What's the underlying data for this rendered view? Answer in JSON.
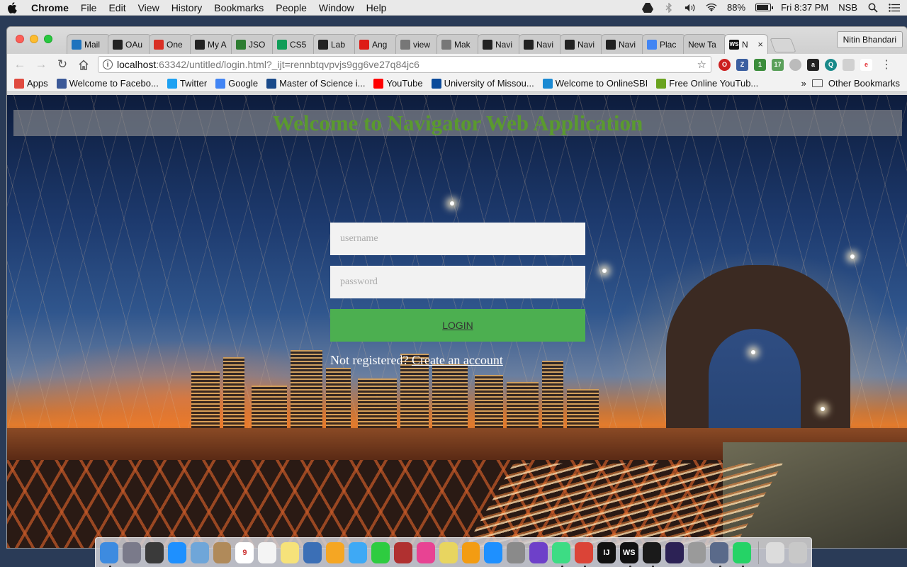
{
  "menubar": {
    "app_name": "Chrome",
    "items": [
      "File",
      "Edit",
      "View",
      "History",
      "Bookmarks",
      "People",
      "Window",
      "Help"
    ],
    "battery": "88%",
    "clock": "Fri 8:37 PM",
    "user": "NSB"
  },
  "browser": {
    "tabs": [
      {
        "label": "Mail",
        "icon": "mail-icon",
        "color": "#1e73be"
      },
      {
        "label": "OAu",
        "icon": "angular-icon",
        "color": "#222222"
      },
      {
        "label": "One",
        "icon": "gmail-icon",
        "color": "#d93025"
      },
      {
        "label": "My A",
        "icon": "webstorm-icon",
        "color": "#222222"
      },
      {
        "label": "JSO",
        "icon": "json-icon",
        "color": "#2e7d32"
      },
      {
        "label": "CS5",
        "icon": "sheets-icon",
        "color": "#0f9d58"
      },
      {
        "label": "Lab",
        "icon": "github-icon",
        "color": "#222222"
      },
      {
        "label": "Ang",
        "icon": "angular-icon",
        "color": "#dd1b16"
      },
      {
        "label": "view",
        "icon": "doc-icon",
        "color": "#777777"
      },
      {
        "label": "Mak",
        "icon": "doc-icon",
        "color": "#777777"
      },
      {
        "label": "Navi",
        "icon": "webstorm-icon",
        "color": "#222222"
      },
      {
        "label": "Navi",
        "icon": "webstorm-icon",
        "color": "#222222"
      },
      {
        "label": "Navi",
        "icon": "webstorm-icon",
        "color": "#222222"
      },
      {
        "label": "Navi",
        "icon": "webstorm-icon",
        "color": "#222222"
      },
      {
        "label": "Plac",
        "icon": "places-icon",
        "color": "#4285f4"
      },
      {
        "label": "New Ta",
        "icon": "",
        "color": ""
      }
    ],
    "active_tab": {
      "label": "N",
      "icon": "webstorm-icon",
      "close": "×"
    },
    "profile_name": "Nitin Bhandari",
    "url_host": "localhost",
    "url_path": ":63342/untitled/login.html?_ijt=rennbtqvpvjs9gg6ve27q84jc6",
    "bookmarks": [
      {
        "label": "Apps",
        "icon": "apps-grid-icon",
        "color": "#e04a3f"
      },
      {
        "label": "Welcome to Facebo...",
        "icon": "facebook-icon",
        "color": "#3b5998"
      },
      {
        "label": "Twitter",
        "icon": "twitter-icon",
        "color": "#1da1f2"
      },
      {
        "label": "Google",
        "icon": "google-icon",
        "color": "#4285f4"
      },
      {
        "label": "Master of Science i...",
        "icon": "university-icon",
        "color": "#1a4a8a"
      },
      {
        "label": "YouTube",
        "icon": "youtube-icon",
        "color": "#ff0000"
      },
      {
        "label": "University of Missou...",
        "icon": "umkc-icon",
        "color": "#0a4a9a"
      },
      {
        "label": "Welcome to OnlineSBI",
        "icon": "sbi-icon",
        "color": "#1b8ad3"
      },
      {
        "label": "Free Online YouTub...",
        "icon": "download-icon",
        "color": "#6aa31f"
      }
    ],
    "other_bookmarks": "Other Bookmarks",
    "overflow": "»"
  },
  "page": {
    "title": "Welcome to Navigator Web Application",
    "username_placeholder": "username",
    "password_placeholder": "password",
    "login_label": "LOGIN",
    "register_prompt": "Not registered? ",
    "register_link": "Create an account"
  },
  "dock": [
    {
      "name": "finder-icon",
      "color": "#3d8be0",
      "running": true
    },
    {
      "name": "launchpad-icon",
      "color": "#7a7a8a",
      "running": false
    },
    {
      "name": "mission-control-icon",
      "color": "#3a3a3a",
      "running": false
    },
    {
      "name": "safari-icon",
      "color": "#1e90ff",
      "running": false
    },
    {
      "name": "preview-icon",
      "color": "#6fa6d9",
      "running": false
    },
    {
      "name": "contacts-icon",
      "color": "#b08a5a",
      "running": false
    },
    {
      "name": "calendar-icon",
      "color": "#ffffff",
      "running": false,
      "text": "9"
    },
    {
      "name": "reminders-icon",
      "color": "#f4f4f4",
      "running": false
    },
    {
      "name": "notes-icon",
      "color": "#f6e27a",
      "running": false
    },
    {
      "name": "photo-booth-icon",
      "color": "#3b6fb6",
      "running": false
    },
    {
      "name": "photos-icon",
      "color": "#f5a623",
      "running": false
    },
    {
      "name": "messages-icon",
      "color": "#3ea9f5",
      "running": false
    },
    {
      "name": "facetime-icon",
      "color": "#2ecc40",
      "running": false
    },
    {
      "name": "photo-slideshow-icon",
      "color": "#b03030",
      "running": false
    },
    {
      "name": "itunes-icon",
      "color": "#e84393",
      "running": false
    },
    {
      "name": "stickies-icon",
      "color": "#e8d560",
      "running": false
    },
    {
      "name": "ibooks-icon",
      "color": "#f39c12",
      "running": false
    },
    {
      "name": "app-store-icon",
      "color": "#1e90ff",
      "running": false
    },
    {
      "name": "system-preferences-icon",
      "color": "#8a8a8a",
      "running": false
    },
    {
      "name": "github-desktop-icon",
      "color": "#6e40c9",
      "running": false
    },
    {
      "name": "android-studio-icon",
      "color": "#3ddc84",
      "running": true
    },
    {
      "name": "chrome-icon",
      "color": "#db4437",
      "running": true
    },
    {
      "name": "intellij-icon",
      "color": "#111111",
      "running": false,
      "text": "IJ"
    },
    {
      "name": "webstorm-icon",
      "color": "#111111",
      "running": true,
      "text": "WS"
    },
    {
      "name": "terminal-icon",
      "color": "#1a1a1a",
      "running": true
    },
    {
      "name": "eclipse-icon",
      "color": "#2c2255",
      "running": false
    },
    {
      "name": "xcode-icon",
      "color": "#9a9a9a",
      "running": false
    },
    {
      "name": "scanner-icon",
      "color": "#5a6a8a",
      "running": true
    },
    {
      "name": "whatsapp-icon",
      "color": "#25d366",
      "running": true
    },
    {
      "name": "downloads-icon",
      "color": "#dcdcdc",
      "running": false
    },
    {
      "name": "trash-icon",
      "color": "#c8c8c8",
      "running": false
    }
  ]
}
